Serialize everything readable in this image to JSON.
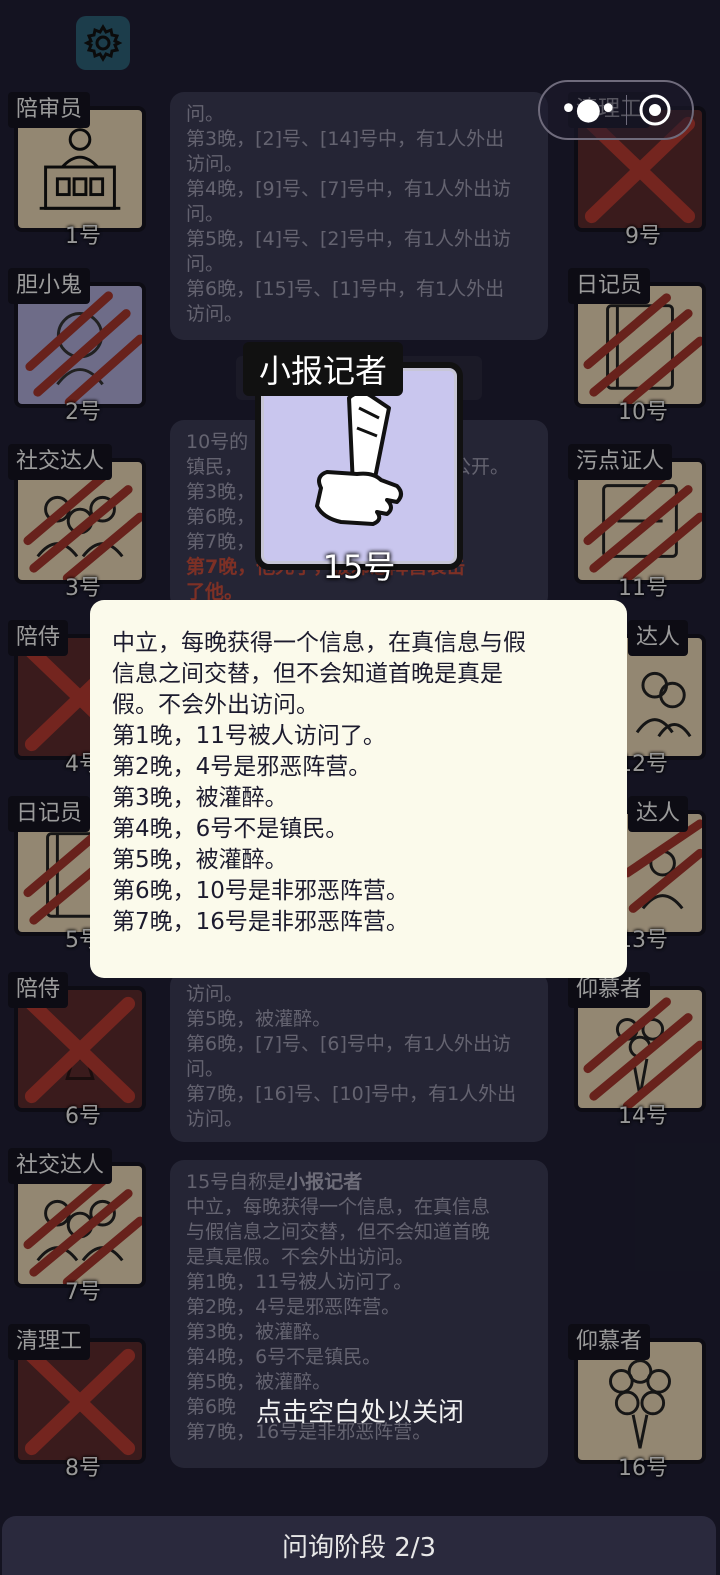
{
  "phase_label": "问询阶段 2/3",
  "close_hint": "点击空白处以关闭",
  "feature": {
    "role": "小报记者",
    "number": "15号"
  },
  "popup_lines": [
    "中立，每晚获得一个信息，在真信息与假",
    "信息之间交替，但不会知道首晚是真是",
    "假。不会外出访问。",
    "第1晚，11号被人访问了。",
    "第2晚，4号是邪恶阵营。",
    "第3晚，被灌醉。",
    "第4晚，6号不是镇民。",
    "第5晚，被灌醉。",
    "第6晚，10号是非邪恶阵营。",
    "第7晚，16号是非邪恶阵营。"
  ],
  "left_players": [
    {
      "role": "陪审员",
      "num": "1号"
    },
    {
      "role": "胆小鬼",
      "num": "2号"
    },
    {
      "role": "社交达人",
      "num": "3号"
    },
    {
      "role": "陪侍",
      "num": "4号"
    },
    {
      "role": "日记员",
      "num": "5号"
    },
    {
      "role": "陪侍",
      "num": "6号"
    },
    {
      "role": "社交达人",
      "num": "7号"
    },
    {
      "role": "清理工",
      "num": "8号"
    }
  ],
  "right_players": [
    {
      "role": "清理工",
      "num": "9号"
    },
    {
      "role": "日记员",
      "num": "10号"
    },
    {
      "role": "污点证人",
      "num": "11号"
    },
    {
      "role": "达人",
      "num": "12号"
    },
    {
      "role": "达人",
      "num": "13号"
    },
    {
      "role": "仰慕者",
      "num": "14号"
    },
    {
      "role": "仰慕者",
      "num": "16号"
    }
  ],
  "log1": [
    "问。",
    "第3晚，[2]号、[14]号中，有1人外出",
    "访问。",
    "第4晚，[9]号、[7]号中，有1人外出访",
    "问。",
    "第5晚，[4]号、[2]号中，有1人外出访",
    "问。",
    "第6晚，[15]号、[1]号中，有1人外出",
    "访问。"
  ],
  "log2": [
    "10号的",
    "镇民，",
    "第3晚，",
    "第6晚，",
    "第7晚，"
  ],
  "log2_fragment": "公开。",
  "log2_red": "第7晚，他死了，被邪恶阵营袭击",
  "log2_red_tail": "了他。",
  "log3": [
    "访问。",
    "第5晚，被灌醉。",
    "第6晚，[7]号、[6]号中，有1人外出访",
    "问。",
    "第7晚，[16]号、[10]号中，有1人外出",
    "访问。"
  ],
  "log4_head_prefix": "15号自称是",
  "log4_head_role": "小报记者",
  "log4": [
    "中立，每晚获得一个信息，在真信息",
    "与假信息之间交替，但不会知道首晚",
    "是真是假。不会外出访问。",
    "第1晚，11号被人访问了。",
    "第2晚，4号是邪恶阵营。",
    "第3晚，被灌醉。",
    "第4晚，6号不是镇民。",
    "第5晚，被灌醉。",
    "第6晚",
    "第7晚，16号是非邪恶阵营。"
  ],
  "colors": {
    "background": "#1f1e33",
    "card_tan": "#e2cfb0",
    "slash_red": "#a0352b",
    "popup_bg": "#fbfaeb"
  }
}
